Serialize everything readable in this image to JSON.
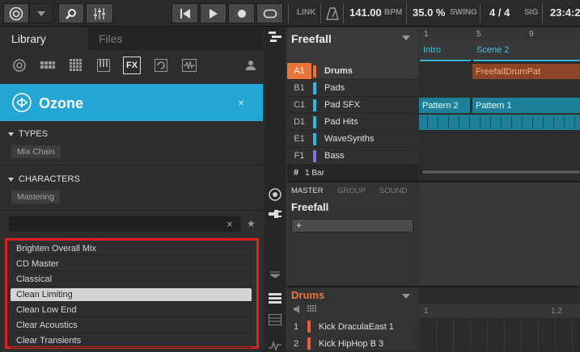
{
  "transport": {
    "link_label": "LINK",
    "bpm_value": "141.00",
    "bpm_label": "BPM",
    "swing_value": "35.0 %",
    "swing_label": "SWING",
    "sig_value": "4 / 4",
    "sig_label": "SIG",
    "time_value": "23:4:2"
  },
  "library": {
    "tab_library": "Library",
    "tab_files": "Files",
    "fx_icon_label": "FX",
    "product_name": "Ozone",
    "close_glyph": "×",
    "types_label": "TYPES",
    "types_tag": "Mix Chain",
    "characters_label": "CHARACTERS",
    "characters_tag": "Mastering",
    "search_placeholder": "",
    "search_clear": "×",
    "star_glyph": "★",
    "results": [
      "Brighten Overall Mix",
      "CD Master",
      "Classical",
      "Clean Limiting",
      "Clean Low End",
      "Clear Acoustics",
      "Clear Transients"
    ],
    "selected_index": 3
  },
  "arranger": {
    "project_name": "Freefall",
    "ruler": [
      "1",
      "5",
      "9"
    ],
    "scenes": [
      "Intro",
      "Scene 2"
    ],
    "groups": [
      {
        "id": "A1",
        "name": "Drums",
        "color": "#e8743c"
      },
      {
        "id": "B1",
        "name": "Pads",
        "color": "#2fb8d8"
      },
      {
        "id": "C1",
        "name": "Pad SFX",
        "color": "#2fb8d8"
      },
      {
        "id": "D1",
        "name": "Pad Hits",
        "color": "#2fb8d8"
      },
      {
        "id": "E1",
        "name": "WaveSynths",
        "color": "#2fb8d8"
      },
      {
        "id": "F1",
        "name": "Bass",
        "color": "#8a6fd8"
      }
    ],
    "clip_drums": "FreefallDrumPat",
    "clip_pattern2": "Pattern 2",
    "clip_pattern1": "Pattern 1",
    "grid_label": "1 Bar",
    "grid_glyph": "#"
  },
  "mixer": {
    "tab_master": "MASTER",
    "tab_group": "GROUP",
    "tab_sound": "SOUND",
    "channel_name": "Freefall",
    "add_glyph": "+"
  },
  "pattern_editor": {
    "group_name": "Drums",
    "ruler": [
      "1",
      "1.2"
    ],
    "sounds": [
      {
        "num": "1",
        "name": "Kick DraculaEast 1",
        "color": "#e85a3c"
      },
      {
        "num": "2",
        "name": "Kick HipHop B 3",
        "color": "#e85a3c"
      }
    ]
  }
}
